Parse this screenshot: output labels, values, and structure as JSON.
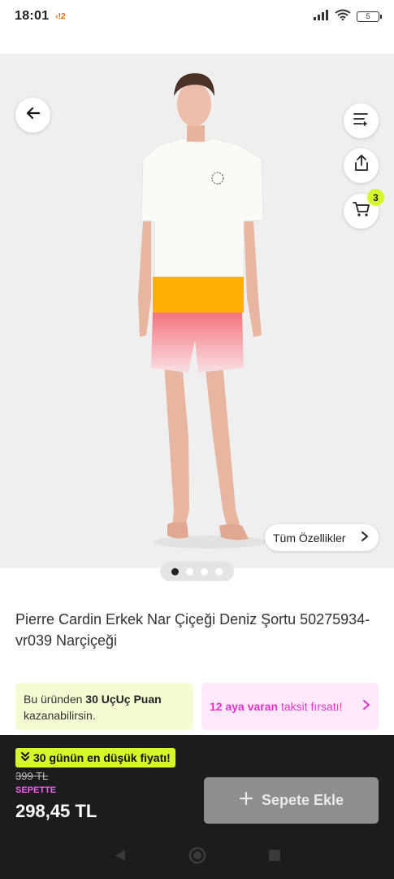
{
  "status": {
    "time": "18:01",
    "app_badge": "‹!2",
    "battery": "5",
    "icons": [
      "signal-icon",
      "wifi-icon",
      "battery-icon"
    ]
  },
  "header_buttons": {
    "back": "back-arrow-icon",
    "filter": "filter-list-icon",
    "share": "share-icon",
    "cart": "cart-icon",
    "cart_count": "3"
  },
  "gallery": {
    "features_label": "Tüm Özellikler",
    "page_count": 4,
    "active_index": 0
  },
  "product": {
    "title": "Pierre Cardin Erkek Nar Çiçeği Deniz Şortu 50275934-vr039 Narçiçeği"
  },
  "points_card": {
    "prefix": "Bu üründen",
    "points": "30 UçUç Puan",
    "suffix": "kazanabilirsin."
  },
  "installment_card": {
    "highlight": "12 aya varan",
    "rest": "taksit fırsatı!"
  },
  "purchase": {
    "lowest_price_badge": "30 günün en düşük fiyatı!",
    "old_price": "399 TL",
    "in_cart_label": "SEPETTE",
    "price": "298,45 TL",
    "add_to_cart": "Sepete Ekle"
  },
  "colors": {
    "accent_lime": "#d6f82b",
    "accent_pink": "#e332d0",
    "bottom_bar": "#1c1c1e"
  }
}
